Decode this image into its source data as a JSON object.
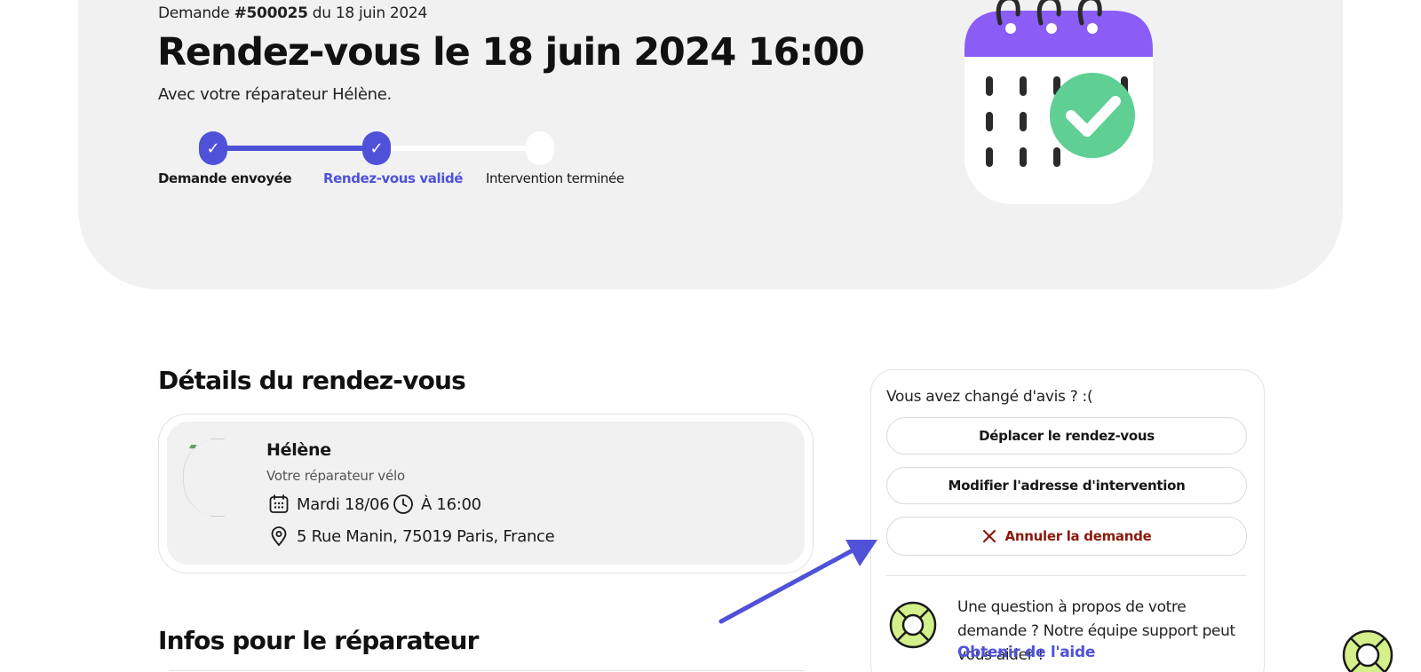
{
  "header": {
    "meta_prefix": "Demande",
    "request_id": "#500025",
    "meta_suffix": "du 18 juin 2024",
    "title": "Rendez-vous le 18 juin 2024 16:00",
    "subtitle": "Avec votre réparateur Hélène."
  },
  "progress": {
    "steps": [
      {
        "label": "Demande envoyée",
        "status": "done"
      },
      {
        "label": "Rendez-vous validé",
        "status": "current"
      },
      {
        "label": "Intervention terminée",
        "status": "todo"
      }
    ],
    "check_glyph": "✓"
  },
  "details": {
    "heading": "Détails du rendez-vous",
    "repairer_name": "Hélène",
    "repairer_role": "Votre réparateur vélo",
    "date": "Mardi 18/06",
    "time": "À 16:00",
    "address": "5 Rue Manin, 75019 Paris, France"
  },
  "infos": {
    "heading": "Infos pour le réparateur"
  },
  "panel": {
    "title": "Vous avez changé d'avis ? :(",
    "move_label": "Déplacer le rendez-vous",
    "edit_address_label": "Modifier l'adresse d'intervention",
    "cancel_label": "Annuler la demande",
    "help_text": "Une question à propos de votre demande ? Notre équipe support peut vous aider !",
    "help_link": "Obtenir de l'aide"
  },
  "colors": {
    "accent": "#4f52d9",
    "danger": "#8a1a0e",
    "calendar_header": "#8b5cf6",
    "success": "#5fcf94",
    "help_icon": "#d4f08a"
  },
  "icons": [
    "calendar-check-icon",
    "calendar-small-icon",
    "clock-icon",
    "location-pin-icon",
    "close-icon",
    "lifebuoy-icon",
    "arrow-annotation"
  ]
}
